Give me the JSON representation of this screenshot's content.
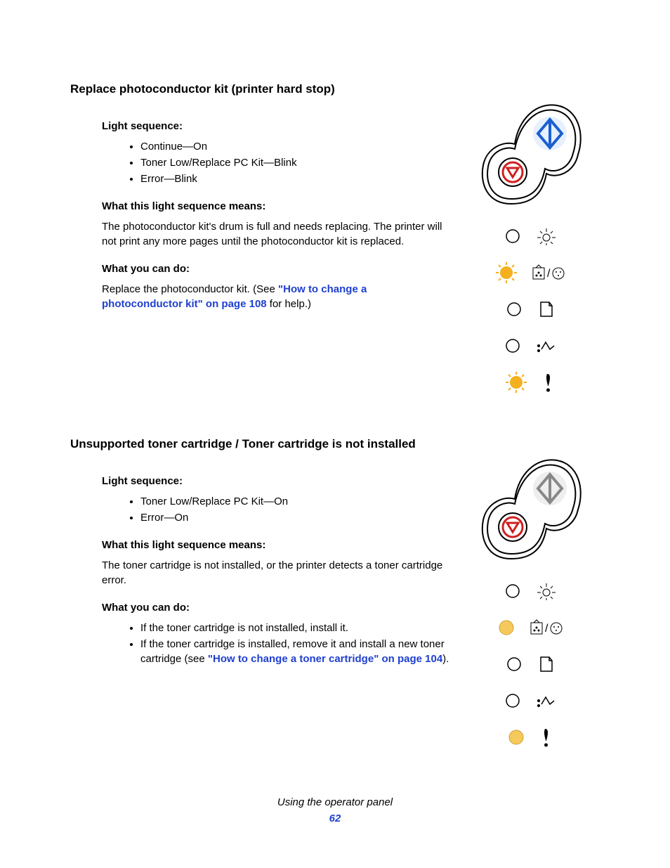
{
  "section1": {
    "title": "Replace photoconductor kit (printer hard stop)",
    "h_light": "Light sequence:",
    "lights": [
      "Continue—On",
      "Toner Low/Replace PC Kit—Blink",
      "Error—Blink"
    ],
    "h_means": "What this light sequence means:",
    "means": "The photoconductor kit's drum is full and needs replacing. The printer will not print any more pages until the photoconductor kit is replaced.",
    "h_do": "What you can do:",
    "do_pre": "Replace the photoconductor kit. (See ",
    "do_link": "\"How to change a photoconductor kit\" on page 108",
    "do_post": " for help.)"
  },
  "section2": {
    "title": "Unsupported toner cartridge / Toner cartridge is not installed",
    "h_light": "Light sequence:",
    "lights": [
      "Toner Low/Replace PC Kit—On",
      "Error—On"
    ],
    "h_means": "What this light sequence means:",
    "means": "The toner cartridge is not installed, or the printer detects a toner cartridge error.",
    "h_do": "What you can do:",
    "do_items": [
      {
        "pre": "If the toner cartridge is not installed, install it.",
        "link": "",
        "post": ""
      },
      {
        "pre": "If the toner cartridge is installed, remove it and install a new toner cartridge (see ",
        "link": "\"How to change a toner cartridge\" on page 104",
        "post": ")."
      }
    ]
  },
  "footer": {
    "text": "Using the operator panel",
    "page": "62"
  }
}
